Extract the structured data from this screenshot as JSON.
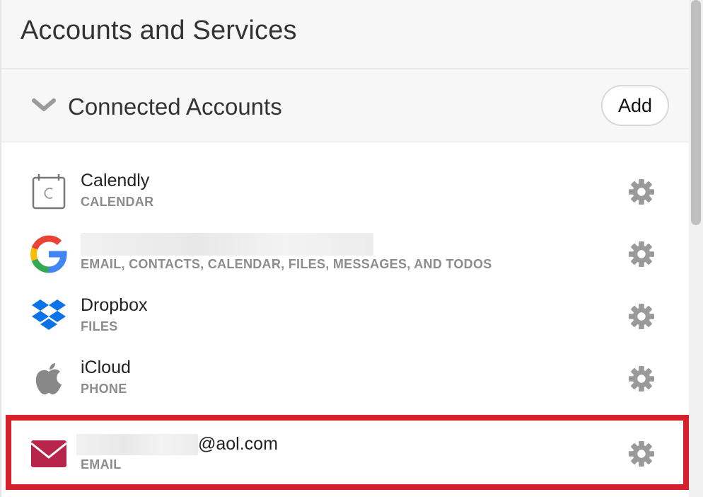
{
  "page": {
    "title": "Accounts and Services"
  },
  "section": {
    "title": "Connected Accounts",
    "add_label": "Add"
  },
  "accounts": [
    {
      "icon": "calendly-icon",
      "name": "Calendly",
      "services": "CALENDAR"
    },
    {
      "icon": "google-icon",
      "name": "",
      "services": "EMAIL, CONTACTS, CALENDAR, FILES, MESSAGES, AND TODOS"
    },
    {
      "icon": "dropbox-icon",
      "name": "Dropbox",
      "services": "FILES"
    },
    {
      "icon": "apple-icon",
      "name": "iCloud",
      "services": "PHONE"
    },
    {
      "icon": "mail-envelope-icon",
      "name": "@aol.com",
      "services": "EMAIL"
    }
  ],
  "colors": {
    "highlight": "#d6212d",
    "mail_icon": "#b8254a",
    "dropbox_icon": "#0b72e8",
    "gear": "#9a9a9a",
    "header_bg": "#f7f7f7"
  }
}
